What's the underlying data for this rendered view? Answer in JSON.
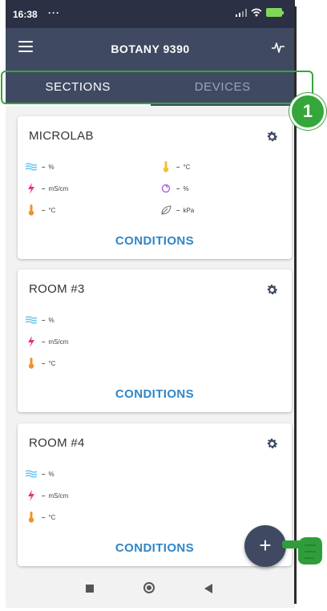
{
  "status_bar": {
    "time": "16:38",
    "dots": "···"
  },
  "app": {
    "title": "BOTANY 9390"
  },
  "tabs": [
    {
      "label": "SECTIONS",
      "active": true
    },
    {
      "label": "DEVICES",
      "active": false
    }
  ],
  "annotation": {
    "step": "1"
  },
  "cards": [
    {
      "name": "MICROLAB",
      "metrics_left": [
        {
          "icon": "humidity-waves-icon",
          "value": "–",
          "unit": "%"
        },
        {
          "icon": "conductivity-bolt-icon",
          "value": "–",
          "unit": "mS/cm"
        },
        {
          "icon": "temperature-icon",
          "value": "–",
          "unit": "°C"
        }
      ],
      "metrics_right": [
        {
          "icon": "temperature-yellow-icon",
          "value": "–",
          "unit": "°C"
        },
        {
          "icon": "moisture-drop-icon",
          "value": "–",
          "unit": "%"
        },
        {
          "icon": "leaf-pressure-icon",
          "value": "–",
          "unit": "kPa"
        }
      ],
      "action": "CONDITIONS"
    },
    {
      "name": "ROOM #3",
      "metrics_left": [
        {
          "icon": "humidity-waves-icon",
          "value": "–",
          "unit": "%"
        },
        {
          "icon": "conductivity-bolt-icon",
          "value": "–",
          "unit": "mS/cm"
        },
        {
          "icon": "temperature-icon",
          "value": "–",
          "unit": "°C"
        }
      ],
      "action": "CONDITIONS"
    },
    {
      "name": "ROOM #4",
      "metrics_left": [
        {
          "icon": "humidity-waves-icon",
          "value": "–",
          "unit": "%"
        },
        {
          "icon": "conductivity-bolt-icon",
          "value": "–",
          "unit": "mS/cm"
        },
        {
          "icon": "temperature-icon",
          "value": "–",
          "unit": "°C"
        }
      ],
      "action": "CONDITIONS"
    }
  ],
  "fab": {
    "label": "+"
  },
  "colors": {
    "appbar": "#3f4a62",
    "accent_link": "#2f86c9",
    "annotation_green": "#35a63a"
  }
}
